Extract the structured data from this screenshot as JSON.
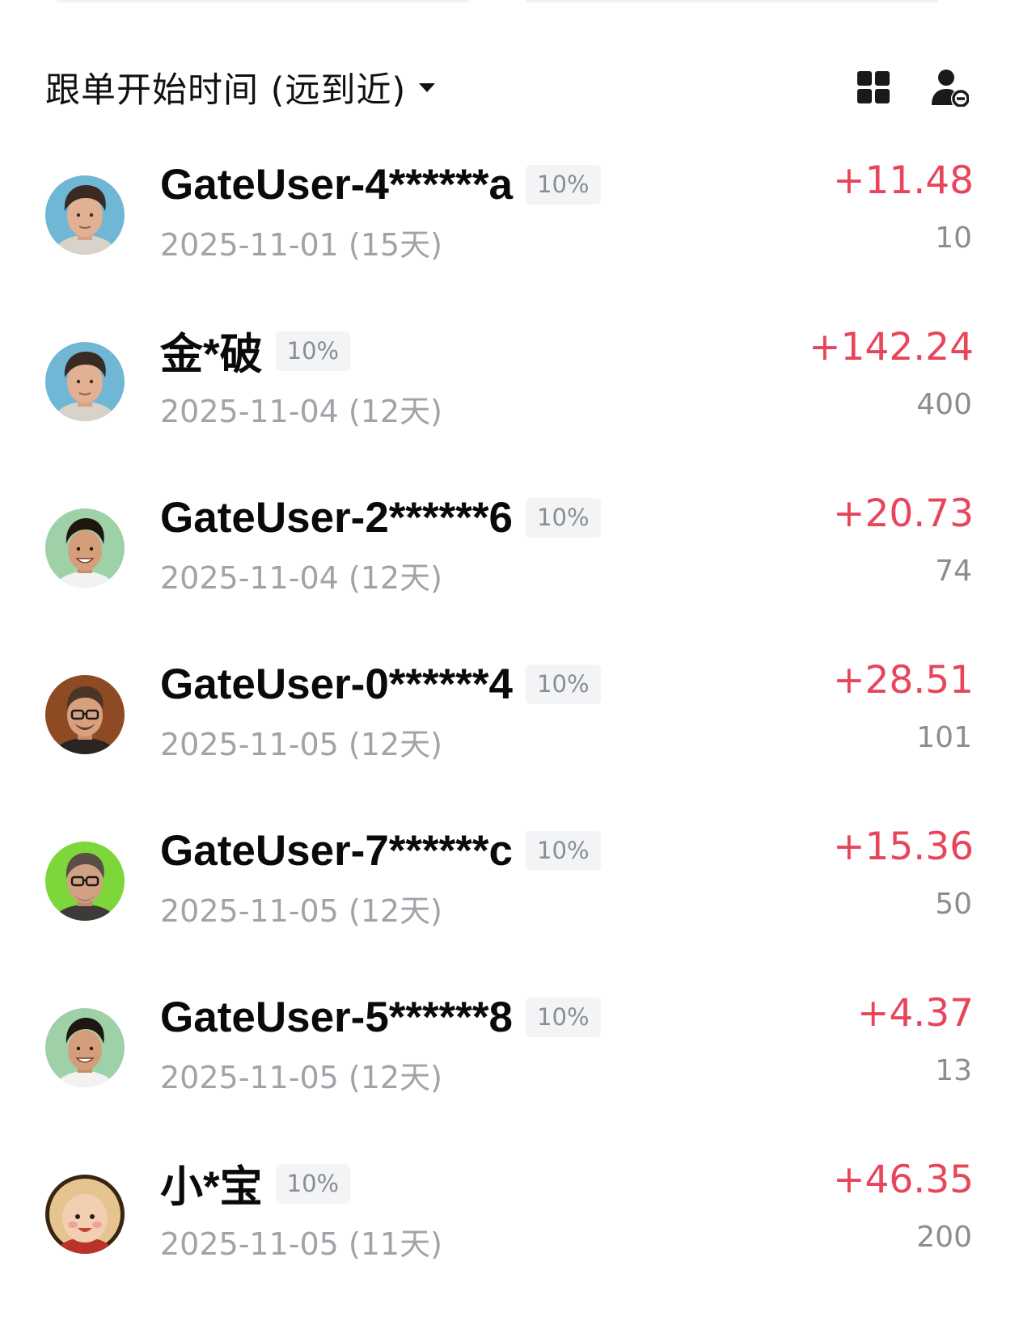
{
  "header": {
    "sort_label": "跟单开始时间 (远到近)",
    "icons": [
      "grid-view-icon",
      "user-settings-icon"
    ]
  },
  "colors": {
    "profit": "#e8455b",
    "muted": "#a0a3a8",
    "tag_bg": "#f3f4f5"
  },
  "followers": [
    {
      "name": "GateUser-4******a",
      "tag": "10%",
      "date": "2025-11-01 (15天)",
      "pnl": "+11.48",
      "amount": "10",
      "avatar": "avatar-young-man-curly"
    },
    {
      "name": "金*破",
      "tag": "10%",
      "date": "2025-11-04 (12天)",
      "pnl": "+142.24",
      "amount": "400",
      "avatar": "avatar-young-man-curly"
    },
    {
      "name": "GateUser-2******6",
      "tag": "10%",
      "date": "2025-11-04 (12天)",
      "pnl": "+20.73",
      "amount": "74",
      "avatar": "avatar-smiling-man-green"
    },
    {
      "name": "GateUser-0******4",
      "tag": "10%",
      "date": "2025-11-05 (12天)",
      "pnl": "+28.51",
      "amount": "101",
      "avatar": "avatar-glasses-man-brown"
    },
    {
      "name": "GateUser-7******c",
      "tag": "10%",
      "date": "2025-11-05 (12天)",
      "pnl": "+15.36",
      "amount": "50",
      "avatar": "avatar-glasses-man-lime"
    },
    {
      "name": "GateUser-5******8",
      "tag": "10%",
      "date": "2025-11-05 (12天)",
      "pnl": "+4.37",
      "amount": "13",
      "avatar": "avatar-smiling-man-green"
    },
    {
      "name": "小*宝",
      "tag": "10%",
      "date": "2025-11-05 (11天)",
      "pnl": "+46.35",
      "amount": "200",
      "avatar": "avatar-baby-cartoon"
    }
  ]
}
